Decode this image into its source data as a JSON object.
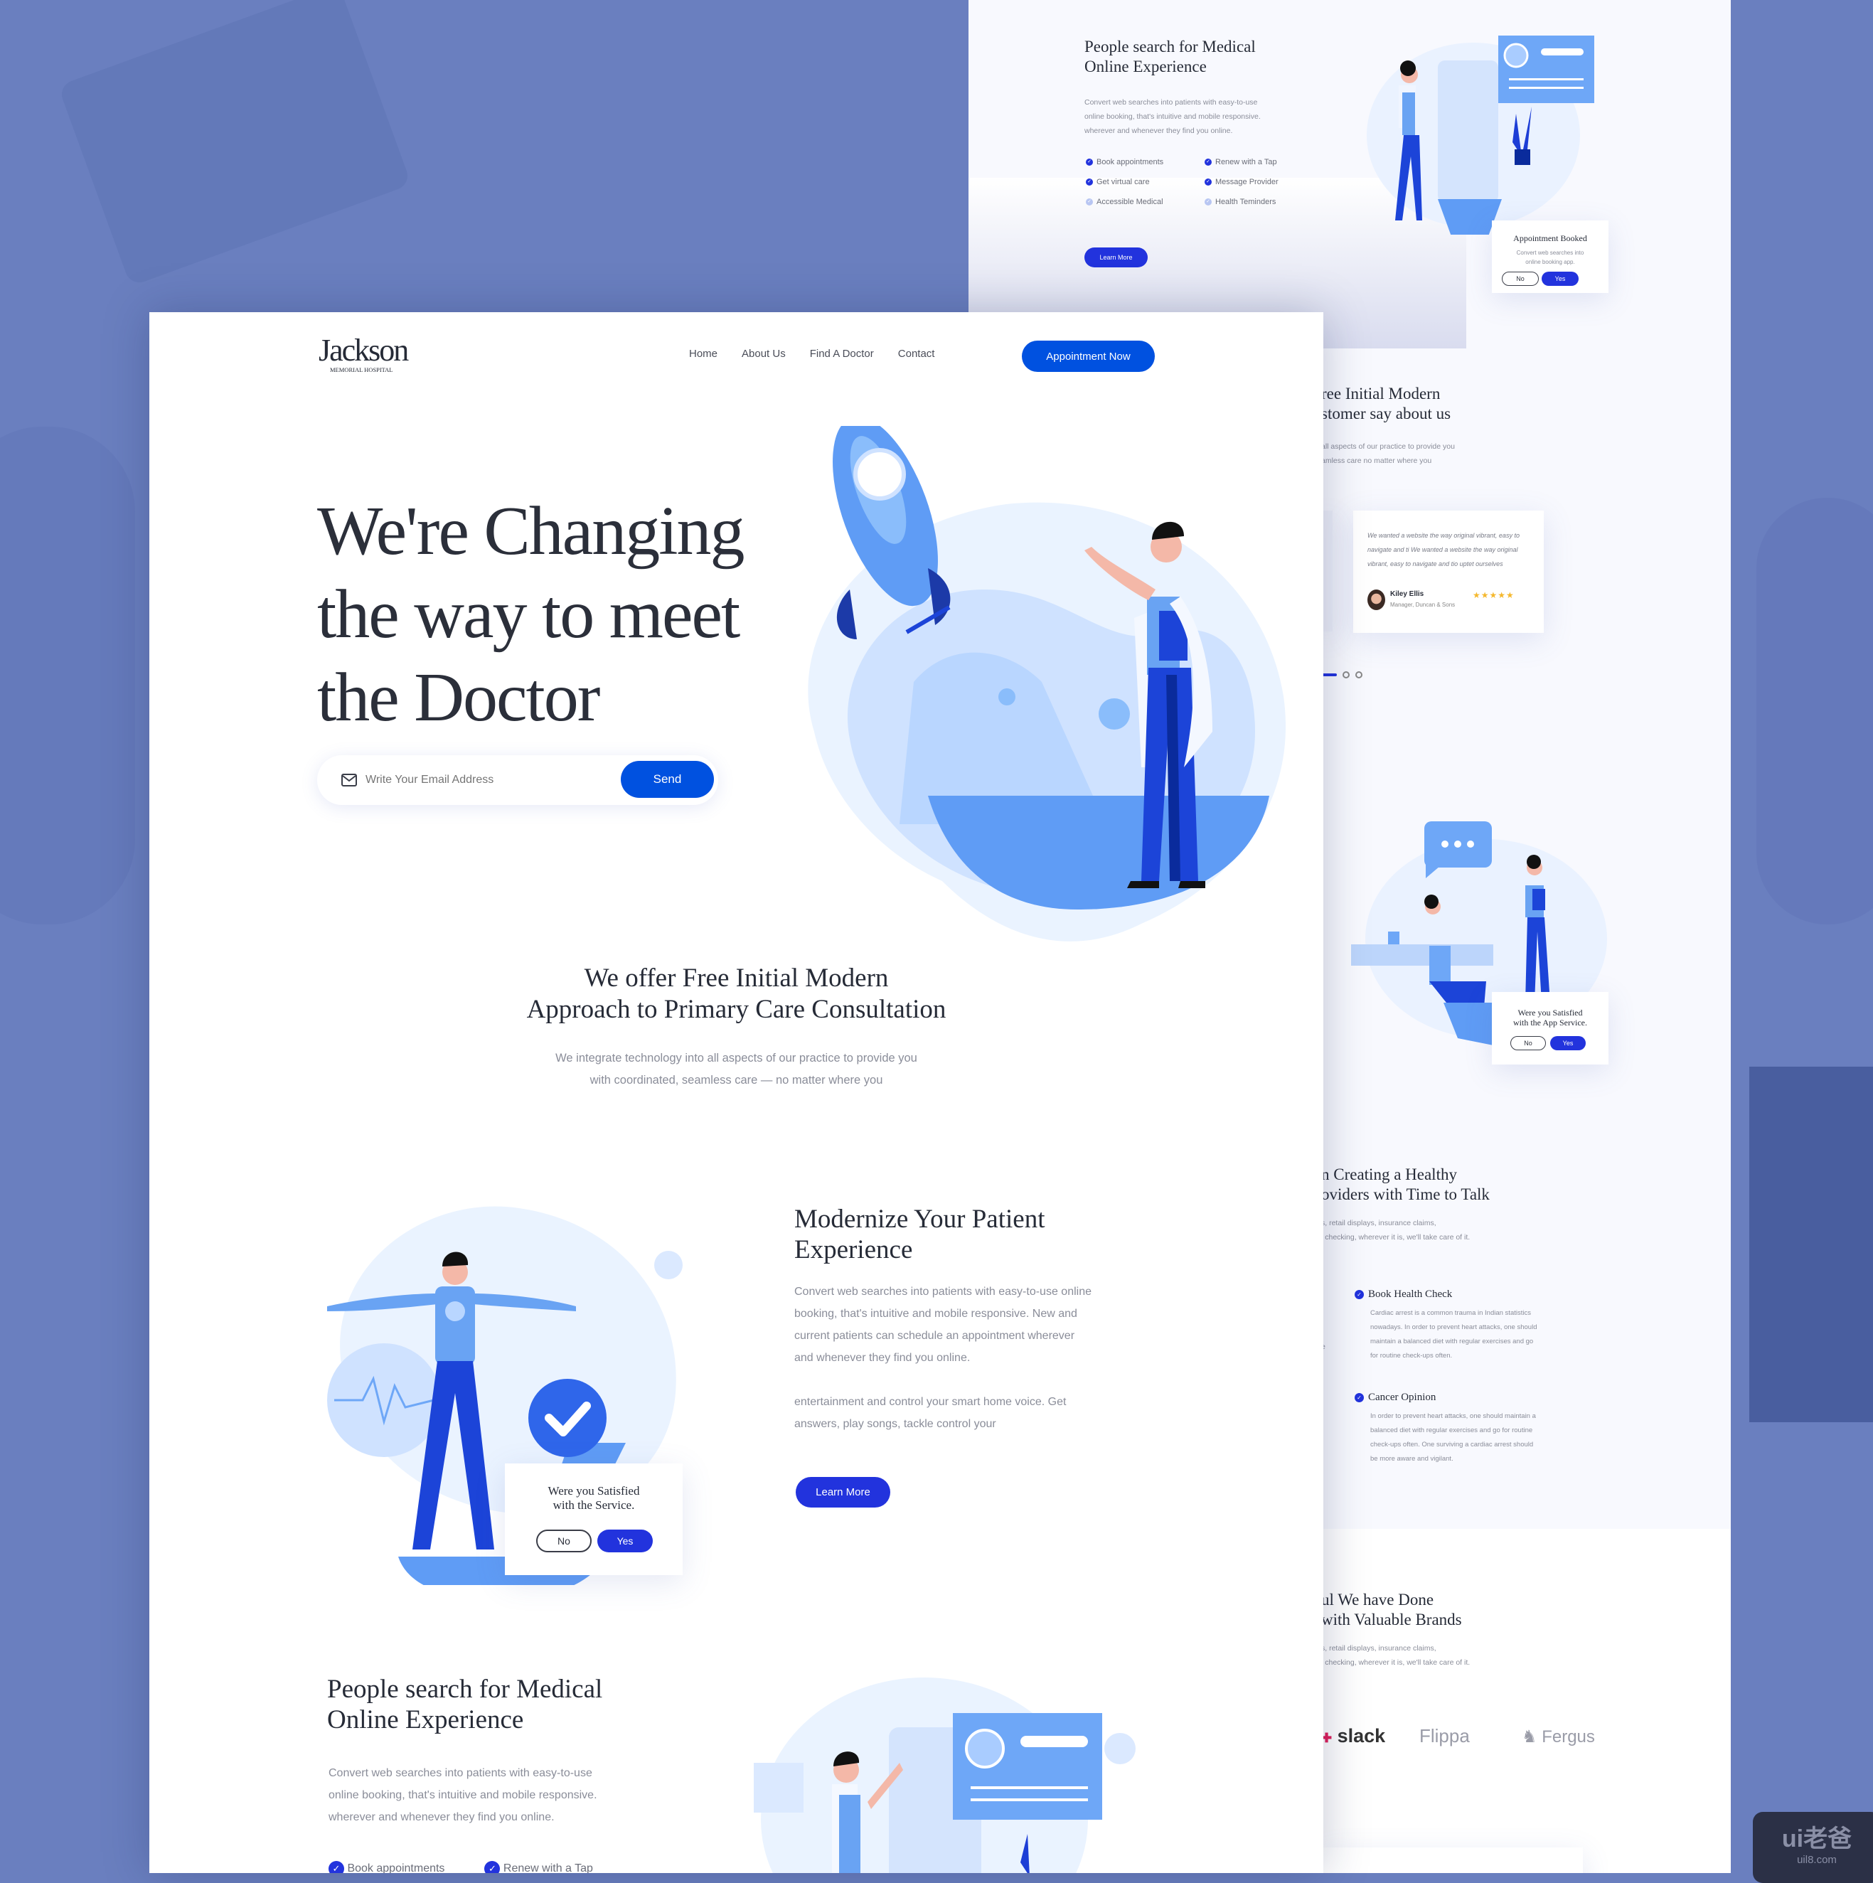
{
  "colors": {
    "accent": "#2233dd",
    "brand_blue": "#0051e0",
    "background": "#6a7fbf",
    "illustration_light": "#cfe2ff",
    "illustration_mid": "#5f9cf5"
  },
  "main": {
    "logo": {
      "name": "Jackson",
      "tagline": "MEMORIAL HOSPITAL"
    },
    "nav": [
      {
        "label": "Home"
      },
      {
        "label": "About Us"
      },
      {
        "label": "Find A Doctor"
      },
      {
        "label": "Contact"
      }
    ],
    "cta": "Appointment Now",
    "hero": {
      "title_lines": [
        "We're Changing",
        "the way to meet",
        "the Doctor"
      ],
      "email_placeholder": "Write Your Email Address",
      "email_icon": "mail-icon",
      "send": "Send"
    },
    "offer": {
      "title_lines": [
        "We offer Free Initial Modern",
        "Approach to Primary Care Consultation"
      ],
      "text_lines": [
        "We integrate technology into all aspects of our practice to provide you",
        "with coordinated, seamless care — no matter where you"
      ]
    },
    "modernize": {
      "title_lines": [
        "Modernize Your Patient",
        "Experience"
      ],
      "para1_lines": [
        "Convert web searches into patients with easy-to-use online",
        "booking, that's intuitive and mobile responsive. New and",
        "current patients can schedule an appointment wherever",
        "and whenever they find you online."
      ],
      "para2_lines": [
        "entertainment and control your smart home voice.  Get",
        "answers, play songs, tackle control your"
      ],
      "button": "Learn More",
      "dialog": {
        "title_lines": [
          "Were you Satisfied",
          "with the Service."
        ],
        "no": "No",
        "yes": "Yes"
      }
    },
    "people": {
      "title_lines": [
        "People search for Medical",
        "Online Experience"
      ],
      "text_lines": [
        "Convert web searches into patients with easy-to-use",
        "online booking, that's intuitive and mobile responsive.",
        "wherever and whenever they find you online."
      ],
      "checks": [
        "Book appointments",
        "Renew with a Tap"
      ]
    }
  },
  "right": {
    "people": {
      "title_lines": [
        "People search for Medical",
        "Online Experience"
      ],
      "text_lines": [
        "Convert web searches into patients with easy-to-use",
        "online booking, that's intuitive and mobile responsive.",
        "wherever and whenever they find you online."
      ],
      "checks": [
        {
          "label": "Book appointments",
          "active": true
        },
        {
          "label": "Renew with a Tap",
          "active": true
        },
        {
          "label": "Get virtual care",
          "active": true
        },
        {
          "label": "Message Provider",
          "active": true
        },
        {
          "label": "Accessible Medical",
          "active": false
        },
        {
          "label": "Health Teminders",
          "active": false
        }
      ],
      "button": "Learn More",
      "dialog": {
        "title": "Appointment Booked",
        "text_lines": [
          "Convert web searches into",
          "online booking app."
        ],
        "no": "No",
        "yes": "Yes"
      }
    },
    "testimonials": {
      "title_lines": [
        "ree Initial Modern",
        "stomer say about us"
      ],
      "text_lines": [
        "all aspects of our practice to provide you",
        "amless care no matter where you"
      ],
      "quote_lines": [
        "We wanted a website the way original vibrant, easy to",
        "navigate and ti We wanted a website the way original",
        "vibrant, easy to navigate and tio uptet ourselves"
      ],
      "author": "Kiley Ellis",
      "role": "Manager, Duncan & Sons",
      "rating": 5,
      "stars": "★★★★★",
      "active_slide": 1,
      "slide_count": 3
    },
    "app_dialog": {
      "title_lines": [
        "Were you Satisfied",
        "with the App Service."
      ],
      "no": "No",
      "yes": "Yes"
    },
    "healthy": {
      "title_lines": [
        "n Creating a Healthy",
        "oviders with Time to Talk"
      ],
      "text_lines": [
        "s, retail displays, insurance claims,",
        "l checking, wherever it is, we'll take care of it."
      ],
      "fragment": "e",
      "items": [
        {
          "title": "Book Health Check",
          "lines": [
            "Cardiac arrest is a common trauma in Indian statistics",
            "nowadays. In order to prevent heart attacks, one should",
            "maintain a balanced diet with regular exercises and go",
            "for routine check-ups often."
          ]
        },
        {
          "title": "Cancer Opinion",
          "lines": [
            "In order to prevent heart attacks, one should maintain a",
            "balanced diet with regular exercises and go for routine",
            "check-ups often. One surviving a cardiac arrest should",
            "be more aware and vigilant."
          ]
        }
      ]
    },
    "brands": {
      "title_lines": [
        "ul We have Done",
        "with Valuable Brands"
      ],
      "text_lines": [
        "s, retail displays, insurance claims,",
        "l checking, wherever it is, we'll take care of it."
      ],
      "logos": [
        "slack",
        "Flippa",
        "Fergus"
      ]
    }
  },
  "watermark": {
    "brand": "ui老爸",
    "url": "uil8.com"
  }
}
